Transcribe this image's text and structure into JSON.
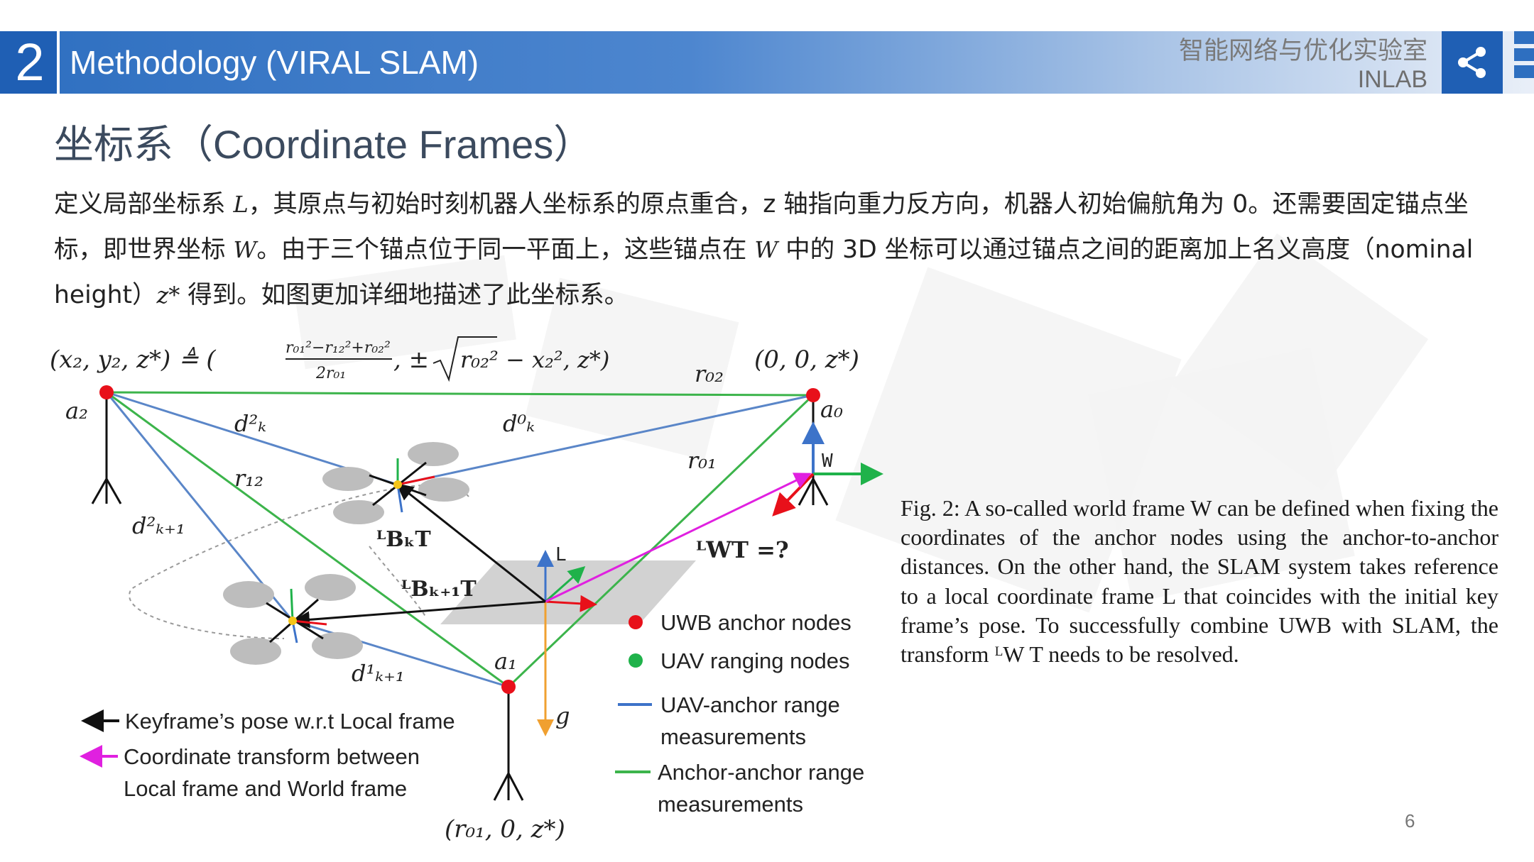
{
  "header": {
    "section_number": "2",
    "section_title": "Methodology (VIRAL SLAM)",
    "lab_name_cn": "智能网络与优化实验室",
    "lab_name_en": "INLAB"
  },
  "icons": {
    "share": "share-icon"
  },
  "slide_title": "坐标系（Coordinate Frames）",
  "paragraph": {
    "p1": "定义局部坐标系 ",
    "v1": "L",
    "p2": "，其原点与初始时刻机器人坐标系的原点重合，z 轴指向重力反方向，机器人初始偏航角为 0。还需要固定锚点坐标，即世界坐标 ",
    "v2": "W",
    "p3": "。由于三个锚点位于同一平面上，这些锚点在 ",
    "v3": "W",
    "p4": " 中的 3D 坐标可以通过锚点之间的距离加上名义高度（nominal height）",
    "v4": "z*",
    "p5": " 得到。如图更加详细地描述了此坐标系。"
  },
  "figure": {
    "a2_coord_lhs": "(x₂, y₂, z*) ≜ (",
    "a2_coord_num": "r₀₁²−r₁₂²+r₀₂²",
    "a2_coord_den": "2r₀₁",
    "a2_coord_rhs": ", ±",
    "a2_coord_sqrt": "r₀₂² − x₂², z*)",
    "a0_coord": "(0, 0, z*)",
    "a1_coord": "(r₀₁, 0, z*)",
    "label_a0": "a₀",
    "label_a1": "a₁",
    "label_a2": "a₂",
    "label_r01": "r₀₁",
    "label_r02": "r₀₂",
    "label_r12": "r₁₂",
    "label_dk0": "d⁰ₖ",
    "label_dk2": "d²ₖ",
    "label_dk1_next": "d¹ₖ₊₁",
    "label_dk2_next": "d²ₖ₊₁",
    "label_W": "W",
    "label_L": "L",
    "label_T_bk": "ᴸBₖT",
    "label_T_bk1": "ᴸBₖ₊₁T",
    "label_T_w": "ᴸWT =?",
    "label_g": "g",
    "legend": [
      {
        "label": "UWB anchor nodes",
        "color": "#e8101a"
      },
      {
        "label": "UAV ranging nodes",
        "color": "#1fb24a"
      },
      {
        "label": "UAV-anchor range measurements",
        "color": "#5a86c8"
      },
      {
        "label": "Anchor-anchor range measurements",
        "color": "#3cb44b"
      }
    ],
    "legend_text": {
      "uwb": "UWB anchor nodes",
      "uav": "UAV ranging nodes",
      "ua1": "UAV-anchor range",
      "ua2": "measurements",
      "aa1": "Anchor-anchor range",
      "aa2": "measurements",
      "kf": "Keyframe’s pose w.r.t Local frame",
      "ct1": "Coordinate transform between",
      "ct2": "Local frame and World frame"
    }
  },
  "caption": "Fig. 2: A so-called world frame W can be defined when fixing the coordinates of the anchor nodes using the anchor-to-anchor distances. On the other hand, the SLAM system takes reference to a local coordinate frame L that coincides with the initial key frame’s pose. To successfully combine UWB with SLAM, the transform ᴸW T needs to be resolved.",
  "page_number": "6"
}
